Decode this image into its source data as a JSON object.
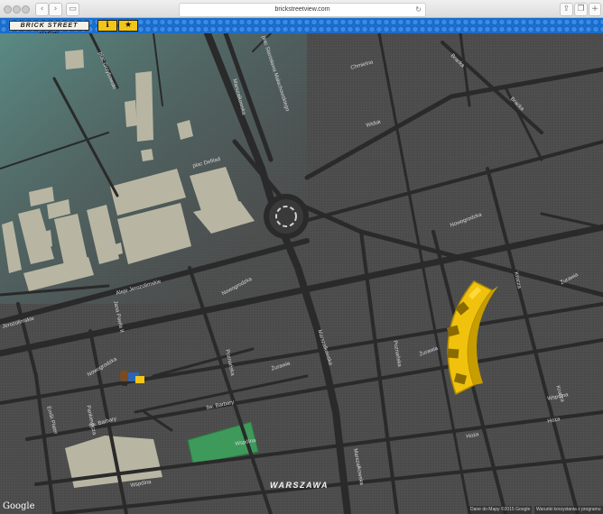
{
  "browser": {
    "url": "brickstreetview.com",
    "back_icon": "‹",
    "forward_icon": "›",
    "sidebar_icon": "▭",
    "reload_icon": "↻",
    "share_icon": "⇪",
    "tabs_icon": "❐"
  },
  "app": {
    "logo": "BRICK STREET VIEW",
    "info_icon": "ℹ",
    "star_icon": "★"
  },
  "map": {
    "streets": [
      "plac Grzybowski",
      "plac Defilad",
      "Aleje Jerozolimskie",
      "Jerozolimskie",
      "Jana Pawła II",
      "Nowogrodzka",
      "Nowogrodzka",
      "Nowogrodzka",
      "Marszałkowska",
      "Marszałkowska",
      "Marszałkowska",
      "plac Stanisława Małachowskiego",
      "Chmielna",
      "Bracka",
      "Bracka",
      "Widok",
      "Krucza",
      "Żurawia",
      "Żurawia",
      "Żurawia",
      "Emilii Plater",
      "Pankiewicza",
      "św. Barbary",
      "św. Barbary",
      "Wspólna",
      "Wspólna",
      "Wspólna",
      "Hoża",
      "Hoża",
      "Krucza",
      "Poznańska",
      "Poznańska"
    ],
    "city_label": "WARSZAWA",
    "google_logo": "Google",
    "attribution_data": "Dane do Mapy ©2015 Google",
    "attribution_report": "Warunki korzystania z programu"
  }
}
